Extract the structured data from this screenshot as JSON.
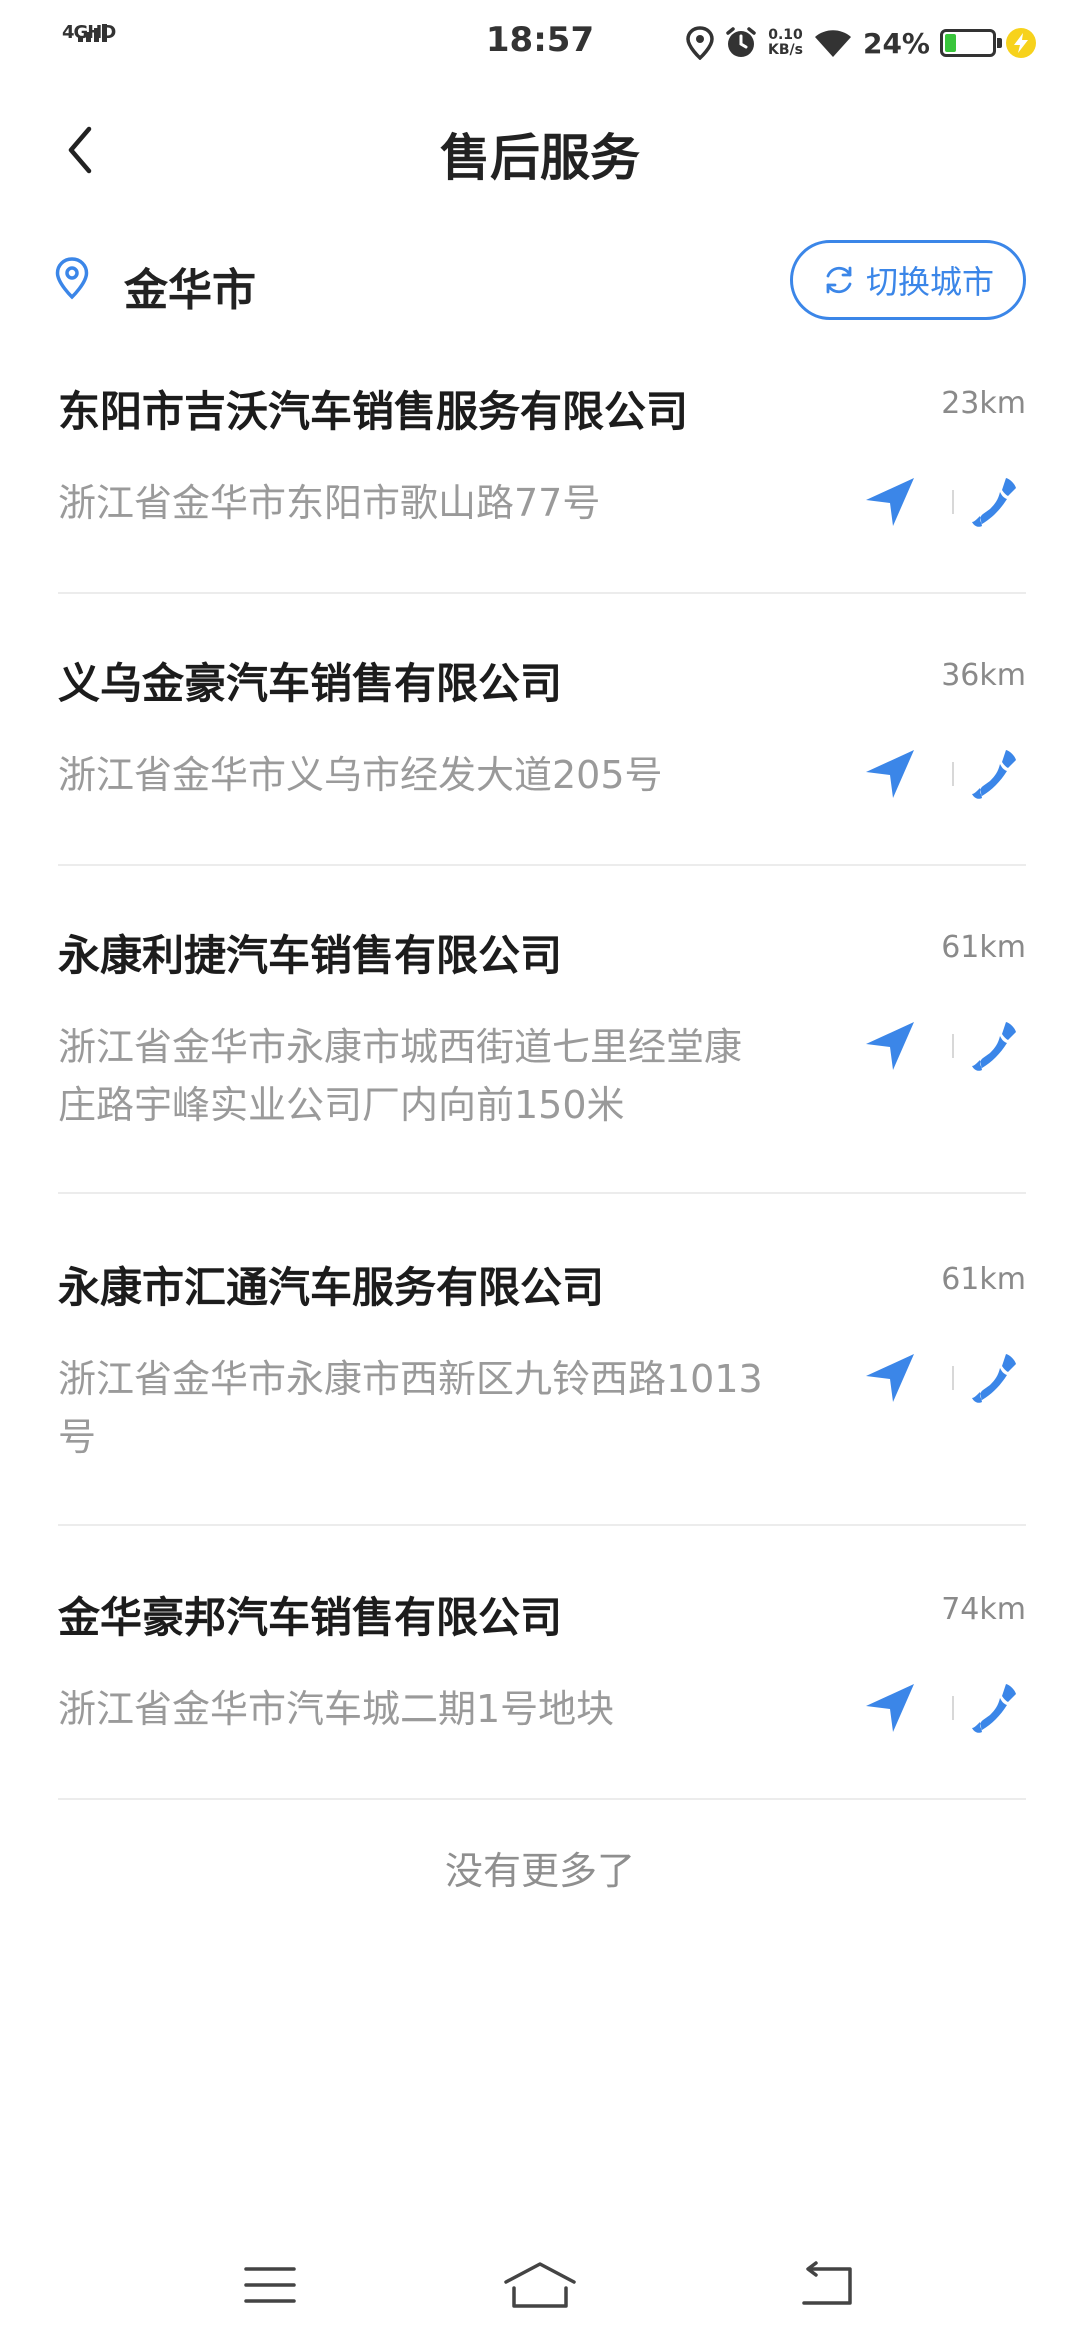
{
  "status_bar": {
    "network": "4GHD",
    "time": "18:57",
    "speed_value": "0.10",
    "speed_unit": "KB/s",
    "battery_text": "24%",
    "battery_level": 0.24
  },
  "header": {
    "title": "售后服务"
  },
  "city": {
    "name": "金华市",
    "switch_label": "切换城市"
  },
  "dealers": [
    {
      "name": "东阳市吉沃汽车销售服务有限公司",
      "distance": "23km",
      "address": "浙江省金华市东阳市歌山路77号"
    },
    {
      "name": "义乌金豪汽车销售有限公司",
      "distance": "36km",
      "address": "浙江省金华市义乌市经发大道205号"
    },
    {
      "name": "永康利捷汽车销售有限公司",
      "distance": "61km",
      "address": "浙江省金华市永康市城西街道七里经堂康庄路宇峰实业公司厂内向前150米"
    },
    {
      "name": "永康市汇通汽车服务有限公司",
      "distance": "61km",
      "address": "浙江省金华市永康市西新区九铃西路1013号"
    },
    {
      "name": "金华豪邦汽车销售有限公司",
      "distance": "74km",
      "address": "浙江省金华市汽车城二期1号地块"
    }
  ],
  "footer": {
    "no_more": "没有更多了"
  },
  "colors": {
    "accent": "#3b86e8",
    "title": "#222222",
    "secondary": "#9a9a9a"
  },
  "icons": {
    "back": "chevron-left-icon",
    "location": "location-pin-icon",
    "refresh": "refresh-icon",
    "navigate": "navigation-arrow-icon",
    "phone": "phone-icon",
    "menu": "menu-icon",
    "home": "home-icon",
    "return": "return-icon"
  }
}
